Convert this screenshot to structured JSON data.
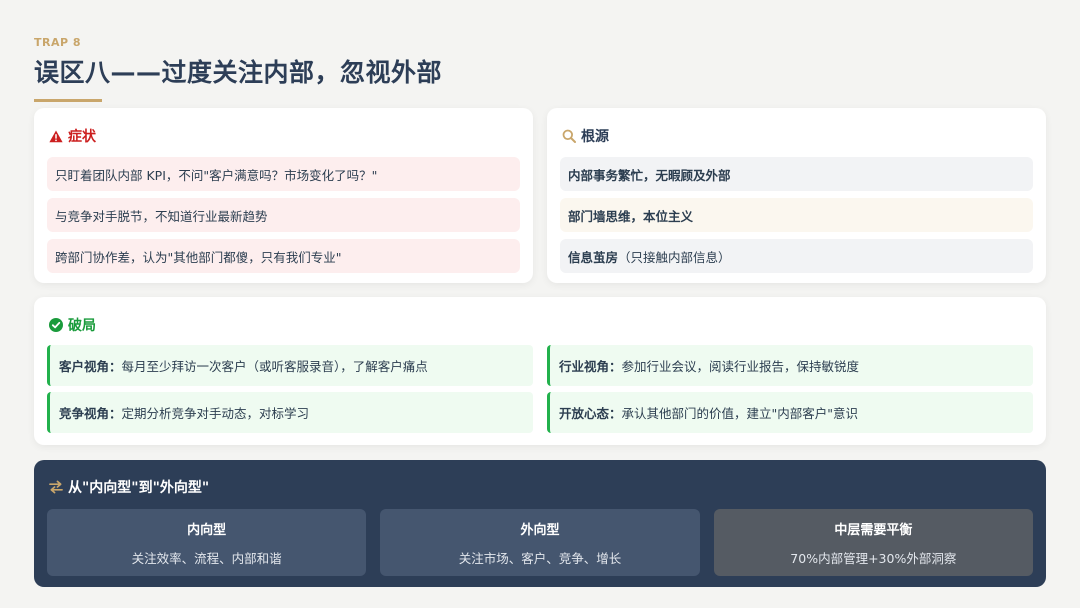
{
  "header": {
    "tag": "TRAP 8",
    "title": "误区八——过度关注内部，忽视外部"
  },
  "symptom": {
    "heading": "症状",
    "icon": "warning-icon",
    "items": [
      "只盯着团队内部 KPI，不问\"客户满意吗？市场变化了吗？\"",
      "与竞争对手脱节，不知道行业最新趋势",
      "跨部门协作差，认为\"其他部门都傻，只有我们专业\""
    ]
  },
  "root_cause": {
    "heading": "根源",
    "icon": "search-icon",
    "items": [
      {
        "text": "内部事务繁忙，无暇顾及外部",
        "extra": ""
      },
      {
        "text": "部门墙思维，本位主义",
        "extra": ""
      },
      {
        "text": "信息茧房",
        "extra": "（只接触内部信息）"
      }
    ]
  },
  "breakout": {
    "heading": "破局",
    "icon": "check-circle-icon",
    "items": [
      {
        "label": "客户视角：",
        "text": "每月至少拜访一次客户（或听客服录音），了解客户痛点"
      },
      {
        "label": "行业视角：",
        "text": "参加行业会议，阅读行业报告，保持敏锐度"
      },
      {
        "label": "竞争视角：",
        "text": "定期分析竞争对手动态，对标学习"
      },
      {
        "label": "开放心态：",
        "text": "承认其他部门的价值，建立\"内部客户\"意识"
      }
    ]
  },
  "transform": {
    "heading": "从\"内向型\"到\"外向型\"",
    "icon": "swap-arrows-icon",
    "boxes": [
      {
        "title": "内向型",
        "desc": "关注效率、流程、内部和谐"
      },
      {
        "title": "外向型",
        "desc": "关注市场、客户、竞争、增长"
      },
      {
        "title": "中层需要平衡",
        "desc": "70%内部管理+30%外部洞察"
      }
    ]
  },
  "colors": {
    "accent_gold": "#c9a66b",
    "navy": "#2d3e57",
    "danger_red": "#cc1f1f",
    "success_green": "#22b14c"
  }
}
